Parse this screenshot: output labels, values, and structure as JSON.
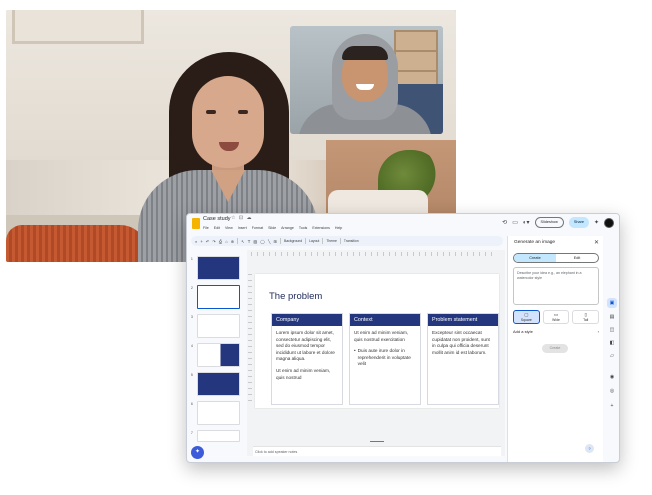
{
  "app": {
    "doc_title": "Case study",
    "menu": [
      "File",
      "Edit",
      "View",
      "Insert",
      "Format",
      "Slide",
      "Arrange",
      "Tools",
      "Extensions",
      "Help"
    ],
    "slideshow_label": "Slideshow",
    "share_label": "Share",
    "toolbar": {
      "background_label": "Background",
      "layout_label": "Layout",
      "theme_label": "Theme",
      "transition_label": "Transition"
    },
    "thumb_numbers": [
      "1",
      "2",
      "3",
      "4",
      "5",
      "6",
      "7"
    ],
    "notes_placeholder": "Click to add speaker notes"
  },
  "slide": {
    "title": "The problem",
    "columns": [
      {
        "header": "Company",
        "paragraphs": [
          "Lorem ipsum dolor sit amet, consectetur adipiscing elit, sed do eiusmod tempor incididunt ut labore et dolore magna aliqua.",
          "Ut enim ad minim veniam, quis nostrud"
        ],
        "bullet": ""
      },
      {
        "header": "Context",
        "paragraphs": [
          "Ut enim ad minim veniam, quis nostrud exercitation"
        ],
        "bullet": "Duis aute irure dolor in reprehenderit in voluptate velit"
      },
      {
        "header": "Problem statement",
        "paragraphs": [
          "Excepteur sint occaecat cupidatat non proident, sunt in culpa qui officia deserunt mollit anim id est laborum."
        ],
        "bullet": ""
      }
    ]
  },
  "panel": {
    "title": "Generate an image",
    "tab_create": "Create",
    "tab_edit": "Edit",
    "prompt_placeholder": "Describe your idea e.g., an elephant in a watercolor style",
    "shapes": [
      "Square",
      "Wide",
      "Tall"
    ],
    "add_style_label": "Add a style",
    "create_label": "Create"
  },
  "colors": {
    "accent": "#24367e",
    "share_bg": "#c2e7ff",
    "selected_blue": "#0b57d0"
  }
}
